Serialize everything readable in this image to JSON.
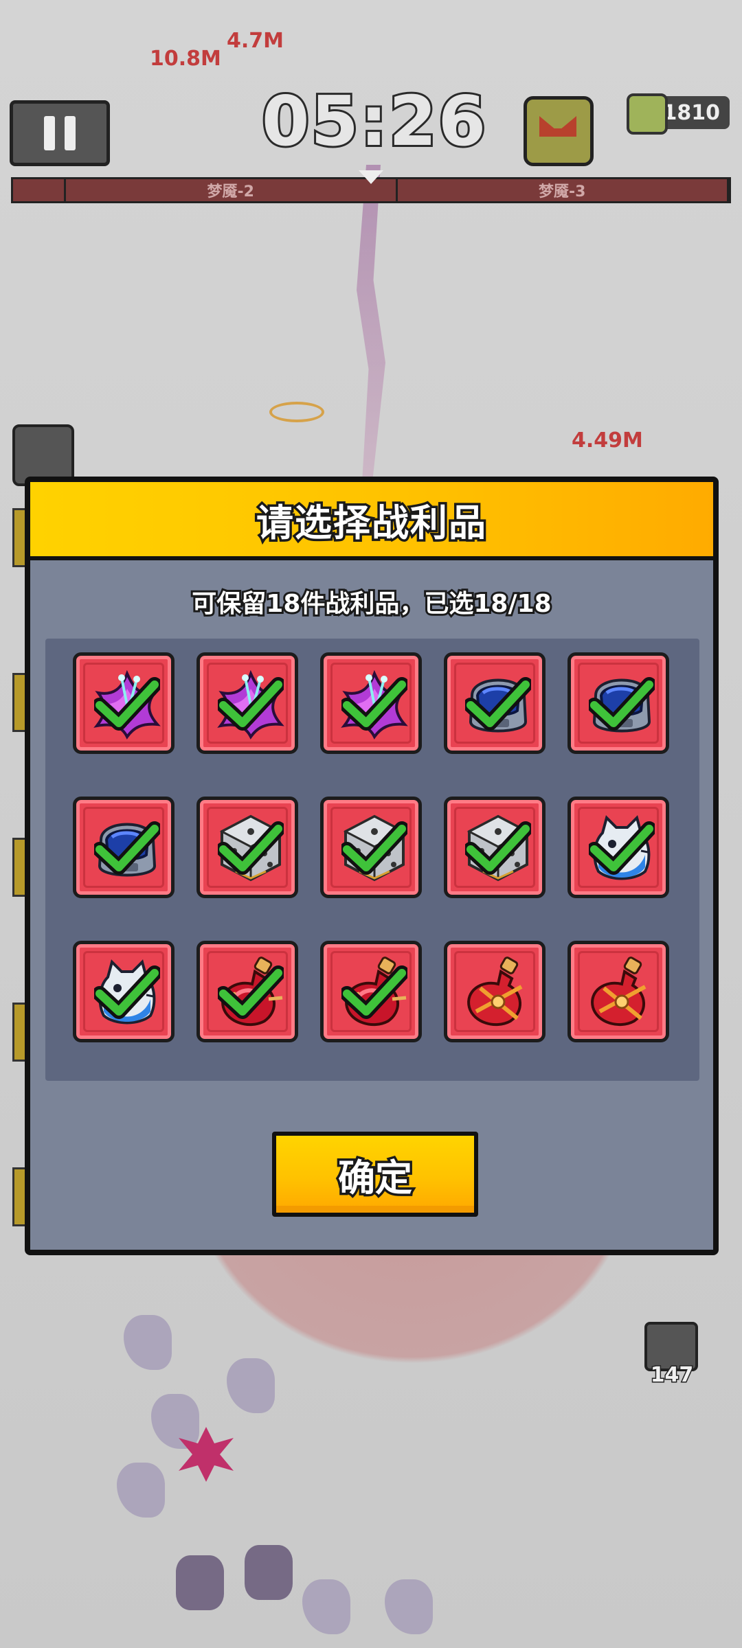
{
  "hud": {
    "timer": "05:26",
    "currency": "1810",
    "progress_segments": [
      "",
      "梦魇-2",
      "梦魇-3"
    ],
    "chest_count": "147",
    "floating_damage": [
      "10.8M",
      "4.7M",
      "4.49M"
    ]
  },
  "modal": {
    "title": "请选择战利品",
    "subtitle": "可保留18件战利品，已选18/18",
    "confirm_label": "确定",
    "items": [
      {
        "icon": "purple-flower-icon",
        "selected": true
      },
      {
        "icon": "purple-flower-icon",
        "selected": true
      },
      {
        "icon": "purple-flower-icon",
        "selected": true
      },
      {
        "icon": "blue-helmet-icon",
        "selected": true
      },
      {
        "icon": "blue-helmet-icon",
        "selected": true
      },
      {
        "icon": "blue-helmet-icon",
        "selected": true
      },
      {
        "icon": "dice-icon",
        "selected": true
      },
      {
        "icon": "dice-icon",
        "selected": true
      },
      {
        "icon": "dice-icon",
        "selected": true
      },
      {
        "icon": "robot-cat-icon",
        "selected": true
      },
      {
        "icon": "robot-cat-icon",
        "selected": true
      },
      {
        "icon": "red-potion-icon",
        "selected": true
      },
      {
        "icon": "red-potion-icon",
        "selected": true
      },
      {
        "icon": "orange-potion-icon",
        "selected": false
      },
      {
        "icon": "orange-potion-icon",
        "selected": false
      }
    ]
  },
  "colors": {
    "slot_red": "#e94352",
    "header_yellow": "#ffc000",
    "check_green": "#3fc23a",
    "panel_gray": "#7b8498"
  }
}
